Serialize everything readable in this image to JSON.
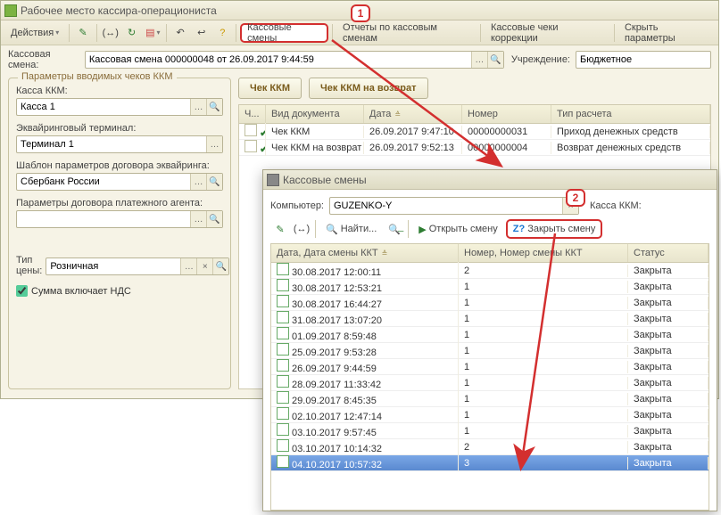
{
  "main_window": {
    "title": "Рабочее место кассира-операциониста"
  },
  "toolbar": {
    "actions_label": "Действия",
    "kass_smeny": "Кассовые смены",
    "reports": "Отчеты по кассовым сменам",
    "correction": "Кассовые чеки коррекции",
    "hide_params": "Скрыть параметры"
  },
  "form": {
    "kass_smena_label": "Кассовая смена:",
    "kass_smena_value": "Кассовая смена 000000048 от 26.09.2017 9:44:59",
    "uchrezhdenie_label": "Учреждение:",
    "uchrezhdenie_value": "Бюджетное"
  },
  "params_box": {
    "legend": "Параметры вводимых чеков ККМ",
    "kassa_kkm_label": "Касса ККМ:",
    "kassa_kkm_value": "Касса 1",
    "acq_term_label": "Эквайринговый терминал:",
    "acq_term_value": "Терминал 1",
    "template_label": "Шаблон параметров договора эквайринга:",
    "template_value": "Сбербанк России",
    "agent_label": "Параметры договора платежного агента:",
    "agent_value": "",
    "price_type_label": "Тип цены:",
    "price_type_value": "Розничная",
    "vat_label": "Сумма включает НДС"
  },
  "buttons": {
    "chek_kkm": "Чек ККМ",
    "chek_kkm_return": "Чек ККМ на возврат"
  },
  "main_table": {
    "col_mark": "Ч...",
    "col_doc": "Вид документа",
    "col_date": "Дата",
    "col_num": "Номер",
    "col_calc": "Тип расчета",
    "rows": [
      {
        "mark": "dbl",
        "doc": "Чек ККМ",
        "date": "26.09.2017 9:47:10",
        "num": "00000000031",
        "calc": "Приход денежных средств"
      },
      {
        "mark": "sgl",
        "doc": "Чек ККМ на возврат",
        "date": "26.09.2017 9:52:13",
        "num": "00000000004",
        "calc": "Возврат денежных средств"
      }
    ]
  },
  "popup": {
    "title": "Кассовые смены",
    "computer_label": "Компьютер:",
    "computer_value": "GUZENKO-Y",
    "kassa_kkm_label": "Касса ККМ:",
    "find": "Найти...",
    "open_shift": "Открыть смену",
    "close_shift": "Закрыть смену",
    "col_date": "Дата, Дата смены ККТ",
    "col_num": "Номер, Номер смены ККТ",
    "col_status": "Статус",
    "rows": [
      {
        "date": "30.08.2017 12:00:11",
        "num": "2",
        "status": "Закрыта",
        "sel": false
      },
      {
        "date": "30.08.2017 12:53:21",
        "num": "1",
        "status": "Закрыта",
        "sel": false
      },
      {
        "date": "30.08.2017 16:44:27",
        "num": "1",
        "status": "Закрыта",
        "sel": false
      },
      {
        "date": "31.08.2017 13:07:20",
        "num": "1",
        "status": "Закрыта",
        "sel": false
      },
      {
        "date": "01.09.2017 8:59:48",
        "num": "1",
        "status": "Закрыта",
        "sel": false
      },
      {
        "date": "25.09.2017 9:53:28",
        "num": "1",
        "status": "Закрыта",
        "sel": false
      },
      {
        "date": "26.09.2017 9:44:59",
        "num": "1",
        "status": "Закрыта",
        "sel": false
      },
      {
        "date": "28.09.2017 11:33:42",
        "num": "1",
        "status": "Закрыта",
        "sel": false
      },
      {
        "date": "29.09.2017 8:45:35",
        "num": "1",
        "status": "Закрыта",
        "sel": false
      },
      {
        "date": "02.10.2017 12:47:14",
        "num": "1",
        "status": "Закрыта",
        "sel": false
      },
      {
        "date": "03.10.2017 9:57:45",
        "num": "1",
        "status": "Закрыта",
        "sel": false
      },
      {
        "date": "03.10.2017 10:14:32",
        "num": "2",
        "status": "Закрыта",
        "sel": false
      },
      {
        "date": "04.10.2017 10:57:32",
        "num": "3",
        "status": "Закрыта",
        "sel": true
      }
    ]
  },
  "callouts": {
    "one": "1",
    "two": "2"
  }
}
